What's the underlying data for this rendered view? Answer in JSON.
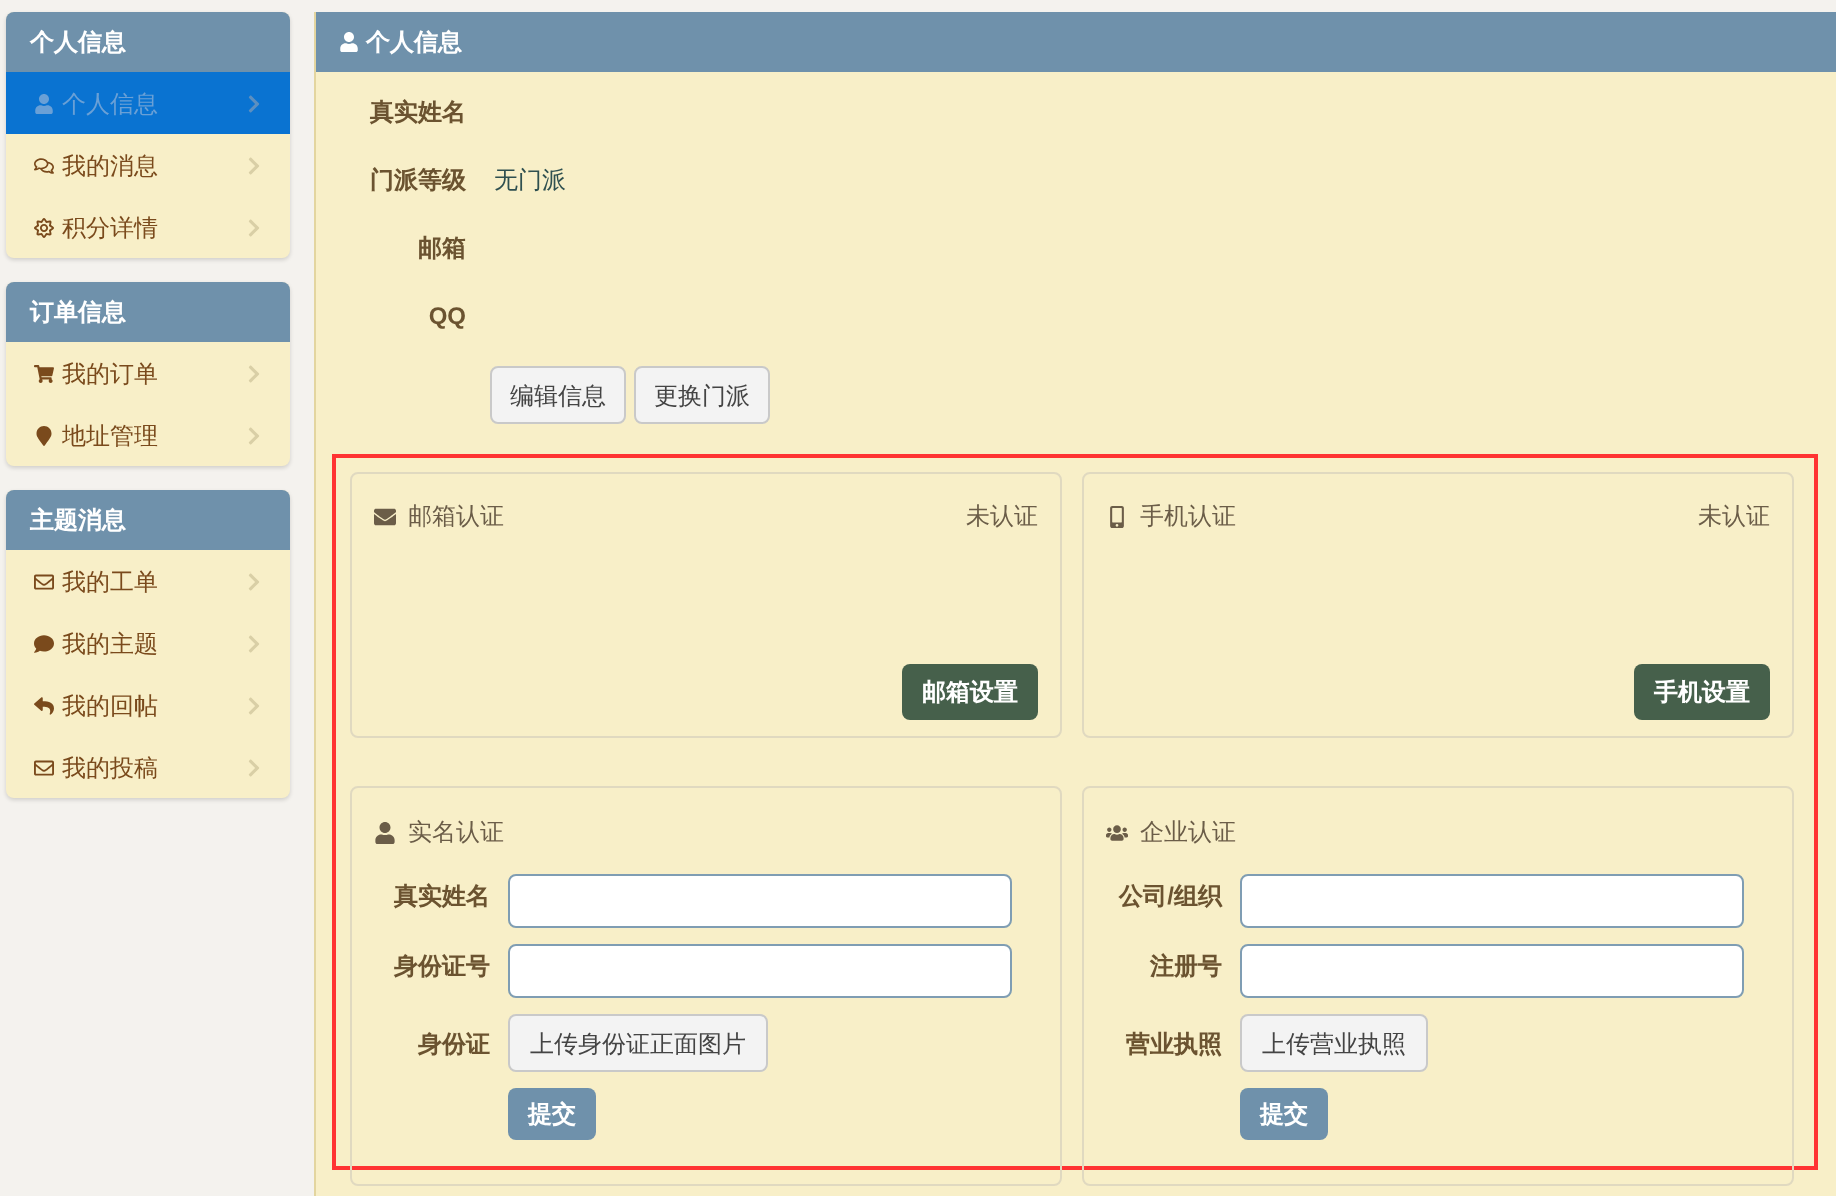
{
  "sidebar": [
    {
      "title": "个人信息",
      "items": [
        {
          "label": "个人信息",
          "selected": true
        },
        {
          "label": "我的消息",
          "selected": false
        },
        {
          "label": "积分详情",
          "selected": false
        }
      ]
    },
    {
      "title": "订单信息",
      "items": [
        {
          "label": "我的订单",
          "selected": false
        },
        {
          "label": "地址管理",
          "selected": false
        }
      ]
    },
    {
      "title": "主题消息",
      "items": [
        {
          "label": "我的工单",
          "selected": false
        },
        {
          "label": "我的主题",
          "selected": false
        },
        {
          "label": "我的回帖",
          "selected": false
        },
        {
          "label": "我的投稿",
          "selected": false
        }
      ]
    }
  ],
  "profile": {
    "title": "个人信息",
    "fields": [
      {
        "label": "真实姓名"
      },
      {
        "label": "门派等级",
        "value": "无门派"
      },
      {
        "label": "邮箱"
      },
      {
        "label": "QQ"
      }
    ],
    "buttons": [
      "编辑信息",
      "更换门派"
    ]
  },
  "verify_cards": [
    {
      "title": "邮箱认证",
      "status": "未认证",
      "button": "邮箱设置"
    },
    {
      "title": "手机认证",
      "status": "未认证",
      "button": "手机设置"
    }
  ],
  "forms": [
    {
      "title": "实名认证",
      "inputs": [
        {
          "label": "真实姓名"
        },
        {
          "label": "身份证号"
        }
      ],
      "upload_label": "身份证",
      "upload_button": "上传身份证正面图片",
      "submit": "提交"
    },
    {
      "title": "企业认证",
      "inputs": [
        {
          "label": "公司/组织"
        },
        {
          "label": "注册号"
        }
      ],
      "upload_label": "营业执照",
      "upload_button": "上传营业执照",
      "submit": "提交"
    }
  ]
}
